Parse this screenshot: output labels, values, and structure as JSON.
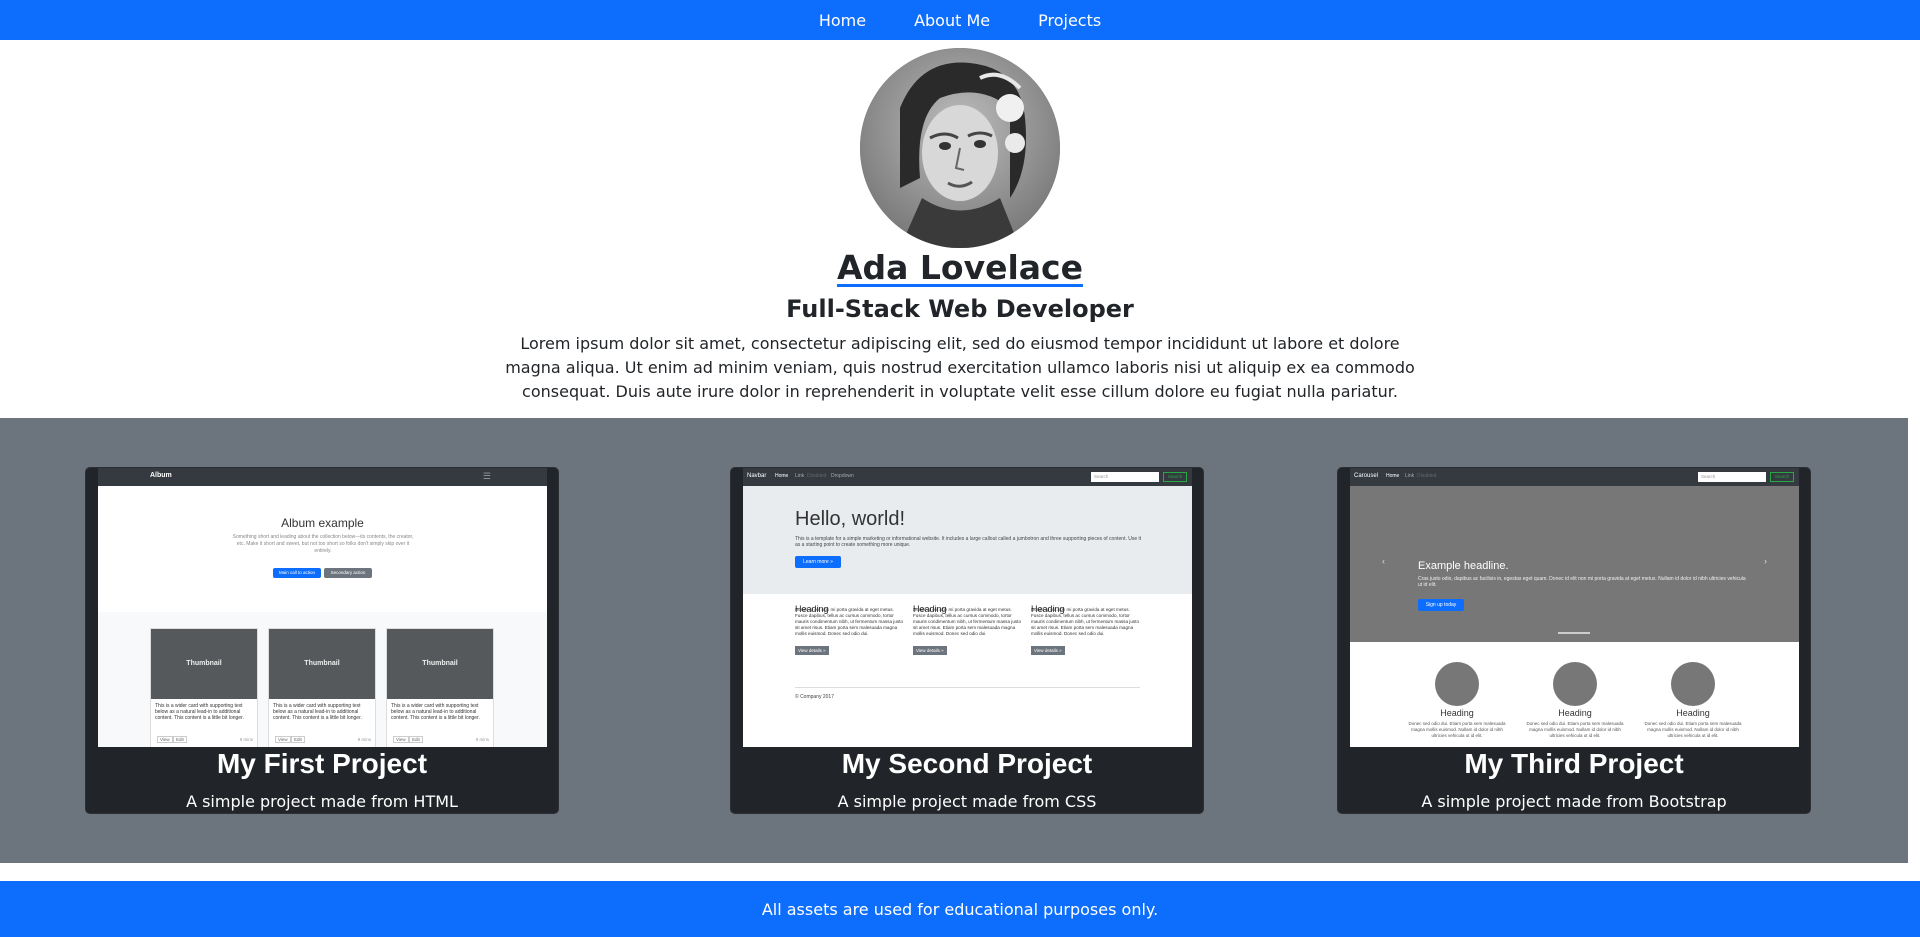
{
  "nav": {
    "links": [
      "Home",
      "About Me",
      "Projects"
    ]
  },
  "hero": {
    "name": "Ada Lovelace",
    "role": "Full-Stack Web Developer",
    "bio": "Lorem ipsum dolor sit amet, consectetur adipiscing elit, sed do eiusmod tempor incididunt ut labore et dolore magna aliqua. Ut enim ad minim veniam, quis nostrud exercitation ullamco laboris nisi ut aliquip ex ea commodo consequat. Duis aute irure dolor in reprehenderit in voluptate velit esse cillum dolore eu fugiat nulla pariatur."
  },
  "projects": [
    {
      "title": "My First Project",
      "text": "A simple project made from HTML",
      "screenshot": {
        "brand": "Album",
        "heading": "Album example",
        "lead": "Something short and leading about the collection below—its contents, the creator, etc. Make it short and sweet, but not too short so folks don't simply skip over it entirely.",
        "primary": "Main call to action",
        "secondary": "Secondary action",
        "thumb": "Thumbnail",
        "card_text": "This is a wider card with supporting text below as a natural lead-in to additional content. This content is a little bit longer.",
        "view": "View",
        "edit": "Edit",
        "mins": "9 mins"
      }
    },
    {
      "title": "My Second Project",
      "text": "A simple project made from CSS",
      "screenshot": {
        "brand": "Navbar",
        "links": [
          "Home",
          "Link",
          "Disabled",
          "Dropdown"
        ],
        "search_placeholder": "Search",
        "search_btn": "Search",
        "jumbo_title": "Hello, world!",
        "jumbo_text": "This is a template for a simple marketing or informational website. It includes a large callout called a jumbotron and three supporting pieces of content. Use it as a starting point to create something more unique.",
        "jumbo_btn": "Learn more »",
        "heading": "Heading",
        "col_text": "Donec id elit non mi porta gravida at eget metus. Fusce dapibus, tellus ac cursus commodo, tortor mauris condimentum nibh, ut fermentum massa justo sit amet risus. Etiam porta sem malesuada magna mollis euismod. Donec sed odio dui.",
        "details_btn": "View details »",
        "footer": "© Company 2017"
      }
    },
    {
      "title": "My Third Project",
      "text": "A simple project made from Bootstrap",
      "screenshot": {
        "brand": "Carousel",
        "links": [
          "Home",
          "Link",
          "Disabled"
        ],
        "search_placeholder": "Search",
        "search_btn": "Search",
        "headline": "Example headline.",
        "caption": "Cras justo odio, dapibus ac facilisis in, egestas eget quam. Donec id elit non mi porta gravida at eget metus. Nullam id dolor id nibh ultricies vehicula ut id elit.",
        "signup": "Sign up today",
        "heading": "Heading",
        "col_text": "Donec sed odio dui. Etiam porta sem malesuada magna mollis euismod. Nullam id dolor id nibh ultricies vehicula ut id elit."
      }
    }
  ],
  "footer": {
    "text": "All assets are used for educational purposes only."
  }
}
